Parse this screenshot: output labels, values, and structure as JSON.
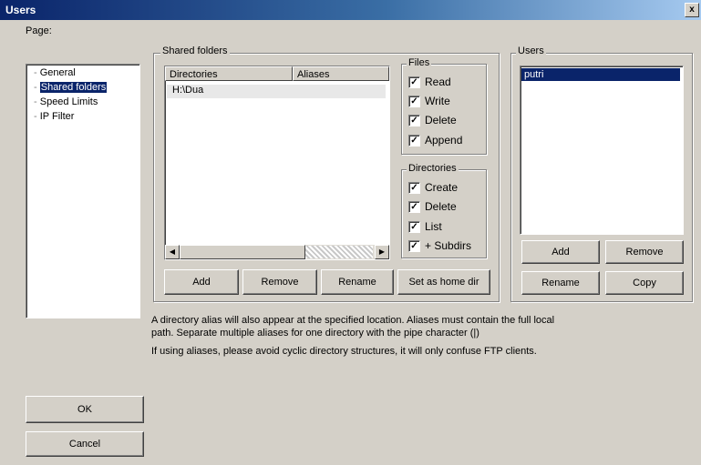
{
  "window": {
    "title": "Users",
    "close": "x"
  },
  "page_tree": {
    "legend": "Page:",
    "items": [
      {
        "label": "General"
      },
      {
        "label": "Shared folders"
      },
      {
        "label": "Speed Limits"
      },
      {
        "label": "IP Filter"
      }
    ]
  },
  "shared_folders": {
    "legend": "Shared folders",
    "columns": [
      "Directories",
      "Aliases"
    ],
    "rows": [
      {
        "directory": "H:\\Dua",
        "alias": ""
      }
    ],
    "buttons": {
      "add": "Add",
      "remove": "Remove",
      "rename": "Rename",
      "home": "Set as home dir"
    }
  },
  "files": {
    "legend": "Files",
    "options": [
      {
        "label": "Read",
        "checked": true
      },
      {
        "label": "Write",
        "checked": true
      },
      {
        "label": "Delete",
        "checked": true
      },
      {
        "label": "Append",
        "checked": true
      }
    ]
  },
  "directories": {
    "legend": "Directories",
    "options": [
      {
        "label": "Create",
        "checked": true
      },
      {
        "label": "Delete",
        "checked": true
      },
      {
        "label": "List",
        "checked": true
      },
      {
        "label": "+ Subdirs",
        "checked": true
      }
    ]
  },
  "users": {
    "legend": "Users",
    "items": [
      {
        "label": "putri",
        "selected": true
      }
    ],
    "buttons": {
      "add": "Add",
      "remove": "Remove",
      "rename": "Rename",
      "copy": "Copy"
    }
  },
  "info": {
    "line1": "A directory alias will also appear at the specified location. Aliases must contain the full local",
    "line2": "path. Separate multiple aliases for one directory with the pipe character (|)",
    "line3": "If using aliases, please avoid cyclic directory structures, it will only confuse FTP clients."
  },
  "footer": {
    "ok": "OK",
    "cancel": "Cancel"
  }
}
